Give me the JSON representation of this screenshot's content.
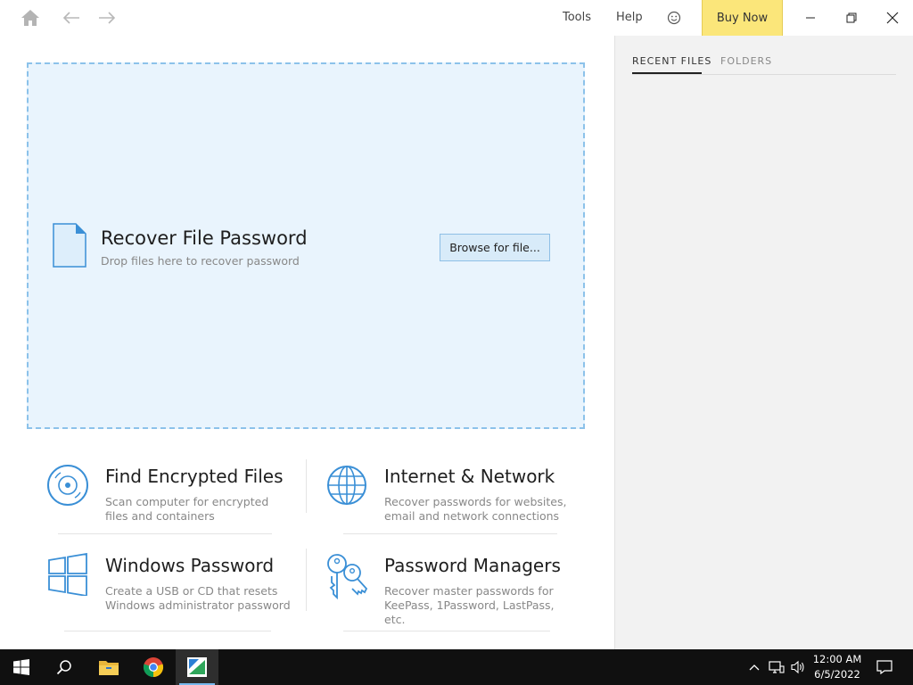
{
  "titlebar": {
    "menu": {
      "tools": "Tools",
      "help": "Help"
    },
    "buy_now": "Buy Now",
    "buy_now_color": "#fbe67a"
  },
  "dropzone": {
    "title": "Recover File Password",
    "subtitle": "Drop files here to recover password",
    "browse_label": "Browse for file...",
    "background": "#e9f4fd",
    "border_color": "#8cc2ea"
  },
  "cards": [
    {
      "icon": "disc-icon",
      "title": "Find Encrypted Files",
      "description": "Scan computer for encrypted\nfiles and containers"
    },
    {
      "icon": "globe-icon",
      "title": "Internet & Network",
      "description": "Recover passwords for websites,\nemail and network connections"
    },
    {
      "icon": "windows-logo-icon",
      "title": "Windows Password",
      "description": "Create a USB or CD that resets\nWindows administrator password"
    },
    {
      "icon": "keys-icon",
      "title": "Password Managers",
      "description": "Recover master passwords for\nKeePass, 1Password, LastPass,\netc."
    }
  ],
  "sidepanel": {
    "tabs": [
      {
        "label": "RECENT FILES",
        "active": true
      },
      {
        "label": "FOLDERS",
        "active": false
      }
    ]
  },
  "taskbar": {
    "apps": [
      "start-icon",
      "search-icon",
      "file-explorer-icon",
      "chrome-icon",
      "password-recovery-app-icon"
    ],
    "clock": {
      "time": "12:00 AM",
      "date": "6/5/2022"
    }
  },
  "colors": {
    "accent": "#3a8fd6",
    "taskbar": "#101010"
  }
}
